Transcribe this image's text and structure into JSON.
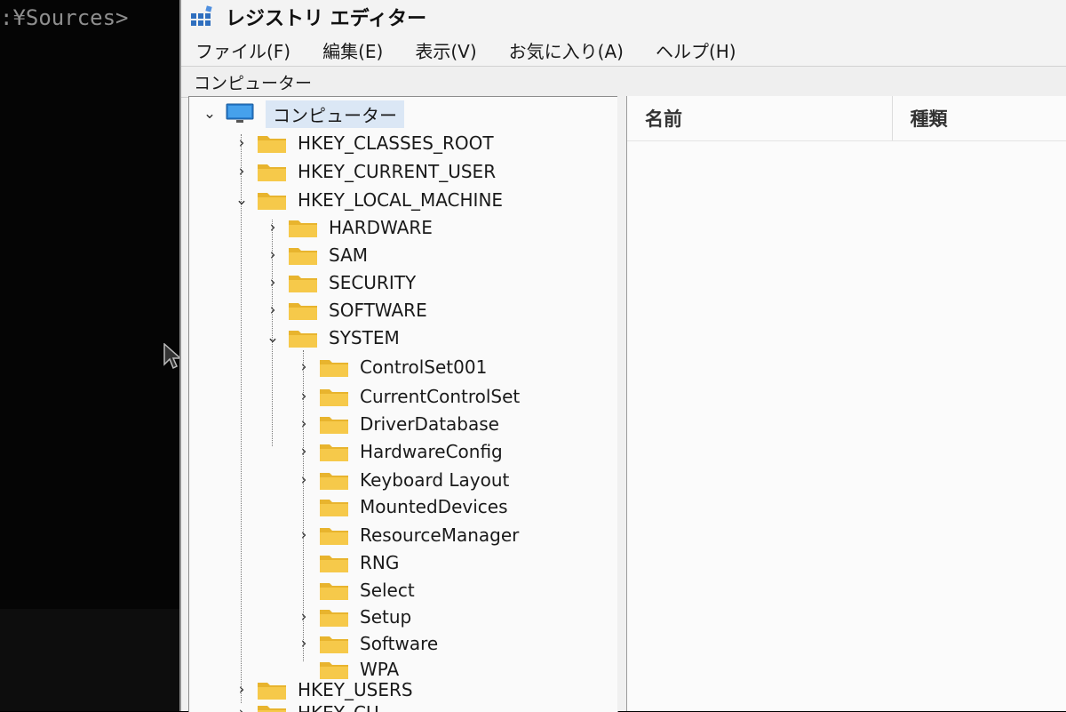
{
  "console": {
    "prompt": ":¥Sources>"
  },
  "window": {
    "title": "レジストリ エディター",
    "menu": [
      "ファイル(F)",
      "編集(E)",
      "表示(V)",
      "お気に入り(A)",
      "ヘルプ(H)"
    ],
    "address": "コンピューター"
  },
  "tree": {
    "root": "コンピューター",
    "hives": {
      "classes_root": "HKEY_CLASSES_ROOT",
      "current_user": "HKEY_CURRENT_USER",
      "local_machine": "HKEY_LOCAL_MACHINE",
      "users": "HKEY_USERS",
      "current_config_partial": "HKEY_CU"
    },
    "hklm_children": [
      "HARDWARE",
      "SAM",
      "SECURITY",
      "SOFTWARE",
      "SYSTEM"
    ],
    "system_children": [
      "ControlSet001",
      "CurrentControlSet",
      "DriverDatabase",
      "HardwareConfig",
      "Keyboard Layout",
      "MountedDevices",
      "ResourceManager",
      "RNG",
      "Select",
      "Setup",
      "Software",
      "WPA"
    ]
  },
  "list": {
    "columns": [
      "名前",
      "種類"
    ]
  },
  "colors": {
    "folder": "#e8b42e",
    "selection": "#dbe7f5"
  },
  "icons": {
    "app": "registry-editor-icon",
    "computer": "computer-icon",
    "folder": "folder-icon",
    "expanded": "chevron-down-icon",
    "collapsed": "chevron-right-icon"
  }
}
